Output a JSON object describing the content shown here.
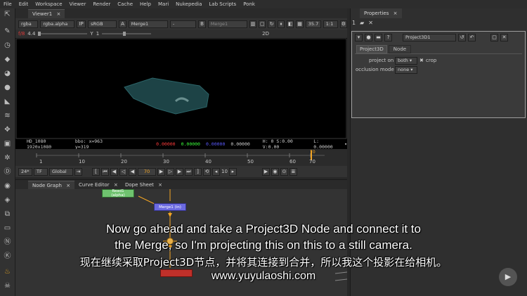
{
  "menu": [
    "File",
    "Edit",
    "Workspace",
    "Viewer",
    "Render",
    "Cache",
    "Help",
    "Mari",
    "Nukepedia",
    "Lab Scripts",
    "Ponk"
  ],
  "viewer": {
    "tab_label": "Viewer1",
    "channels": "rgba",
    "alpha": "rgba.alpha",
    "ip": "IP",
    "colorspace": "sRGB",
    "a_label": "A",
    "a_input": "Merge1",
    "compare_op": "-",
    "b_label": "B",
    "b_input": "Merge1",
    "zoom": "35.7",
    "ratio": "1:1",
    "mode": "2D",
    "gain_label": "f/8",
    "gain_value": "4.4",
    "y_label": "Y",
    "y_value": "1"
  },
  "status": {
    "format": "HD_1080 1920x1080",
    "bbox": "bbo: x=963 y=319",
    "r": "0.00000",
    "g": "0.00000",
    "b": "0.00000",
    "a": "0.00000",
    "hsv": "H: 0 S:0.00 V:0.00",
    "l": "L: 0.00000"
  },
  "timeline": {
    "ticks": [
      "1",
      "10",
      "20",
      "30",
      "40",
      "50",
      "60",
      "70"
    ],
    "current_frame_marker": "70"
  },
  "playback": {
    "fps": "24*",
    "tf": "TF",
    "range": "Global",
    "frame": "70",
    "step": "10"
  },
  "node_graph": {
    "tabs": [
      "Node Graph",
      "Curve Editor",
      "Dope Sheet"
    ],
    "nodes": {
      "read_label": "Read1",
      "read_sub": "(alpha)",
      "merge_label": "Merge1 (in)"
    }
  },
  "properties": {
    "tab_label": "Properties",
    "node_name": "Project3D1",
    "node_tabs": [
      "Project3D",
      "Node"
    ],
    "project_on_label": "project on",
    "project_on_value": "both",
    "crop_label": "crop",
    "occlusion_label": "occlusion mode",
    "occlusion_value": "none"
  },
  "subtitles": {
    "line1": "Now go ahead and take a Project3D Node and connect it to",
    "line2": "the Merge, so I'm projecting this on this to a still camera.",
    "line3_zh": "现在继续采取Project3D节点，并将其连接到合并，所以我这个投影在给相机。",
    "line4": "www.yuyulaoshi.com"
  },
  "colors": {
    "accent_orange": "#f5a623",
    "merge_node": "#6b6ae0",
    "read_node": "#6fc36f",
    "red_node": "#c0302a",
    "viewer_red": "#e03a3a",
    "status_red": "#ff3b3b",
    "status_green": "#3bff3b",
    "status_blue": "#5a5aff"
  },
  "icons": [
    "pencil-icon",
    "clock-icon",
    "shapes-icon",
    "image-icon",
    "palette-icon",
    "circle-icon",
    "brush-icon",
    "layers-icon",
    "move-icon",
    "cube-icon",
    "particles-icon",
    "deep-icon",
    "views-icon",
    "tag-icon",
    "merge-icon",
    "folder-icon",
    "script-icon",
    "keyer-icon",
    "skull-icon"
  ]
}
